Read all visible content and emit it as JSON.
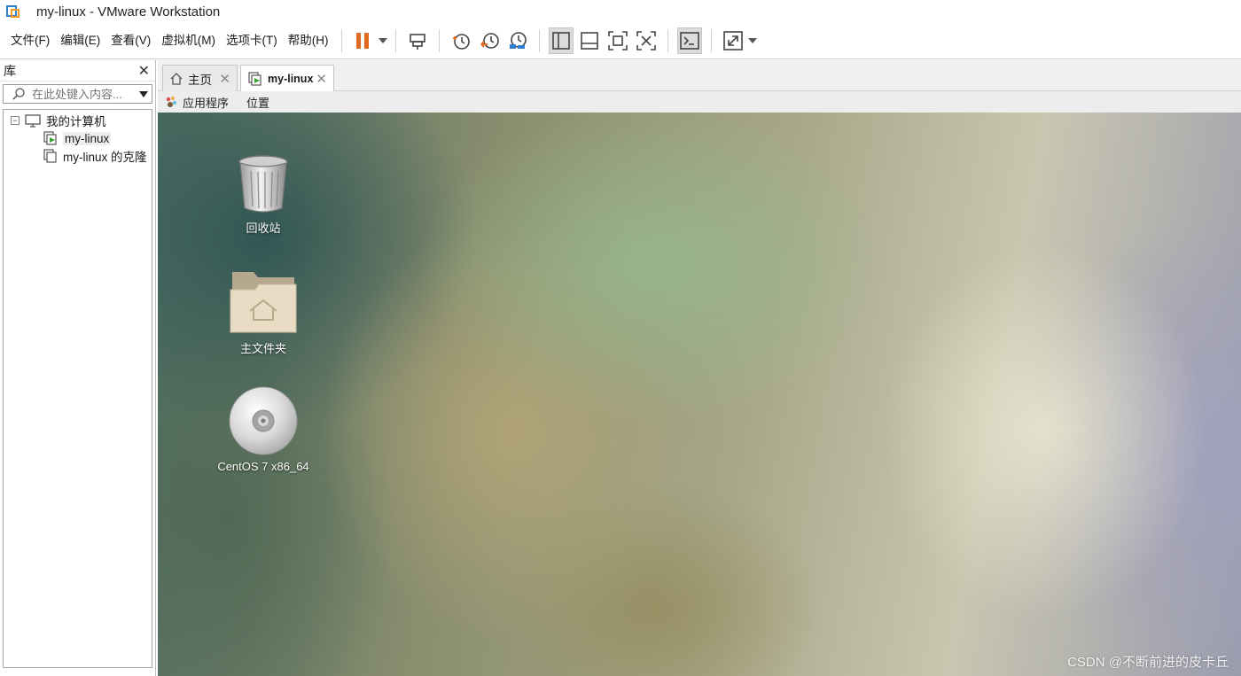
{
  "window": {
    "title": "my-linux - VMware Workstation"
  },
  "menu": [
    {
      "label": "文件(F)"
    },
    {
      "label": "编辑(E)"
    },
    {
      "label": "查看(V)"
    },
    {
      "label": "虚拟机(M)"
    },
    {
      "label": "选项卡(T)"
    },
    {
      "label": "帮助(H)"
    }
  ],
  "toolbar": {
    "buttons": [
      "pause-icon",
      "send-keys-icon",
      "snapshot-icon",
      "revert-snapshot-icon",
      "snapshot-manager-icon",
      "show-library-icon",
      "thumbnail-bar-icon",
      "full-screen-icon",
      "unity-icon",
      "console-view-icon",
      "stretch-icon"
    ],
    "pause_color": "#e06a1f"
  },
  "library": {
    "title": "库",
    "close": "✕",
    "search_placeholder": "在此处键入内容...",
    "tree": {
      "root": {
        "label": "我的计算机",
        "expander": "⊟"
      },
      "children": [
        {
          "label": "my-linux",
          "selected": true,
          "running": true
        },
        {
          "label": "my-linux 的克隆",
          "selected": false,
          "running": false
        }
      ]
    }
  },
  "tabs": [
    {
      "label": "主页",
      "close": "✕"
    },
    {
      "label": "my-linux",
      "close": "✕",
      "active": true
    }
  ],
  "guest": {
    "panel": {
      "applications": "应用程序",
      "places": "位置"
    },
    "desktop_icons": [
      {
        "label": "回收站",
        "icon": "trash-icon"
      },
      {
        "label": "主文件夹",
        "icon": "home-folder-icon"
      },
      {
        "label": "CentOS 7 x86_64",
        "icon": "cd-icon"
      }
    ]
  },
  "watermark": "CSDN @不断前进的皮卡丘"
}
